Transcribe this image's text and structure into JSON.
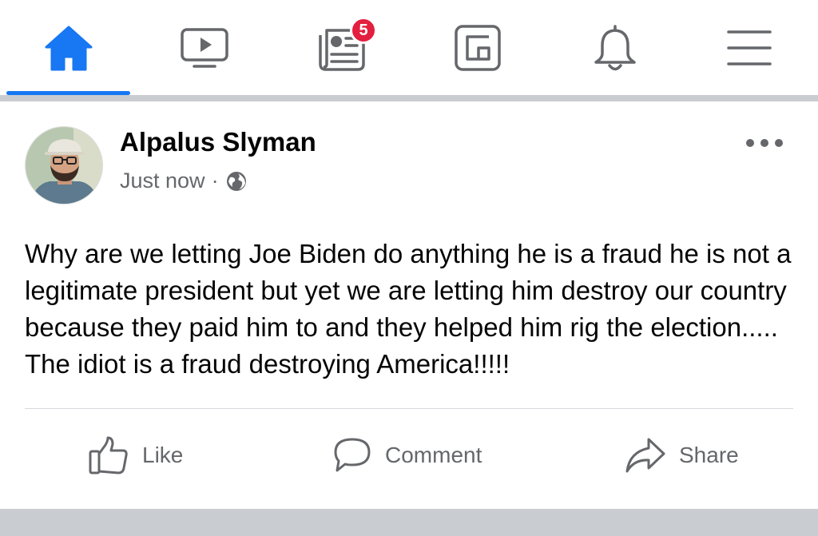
{
  "nav": {
    "tabs": [
      {
        "name": "home",
        "icon": "home-icon",
        "active": true
      },
      {
        "name": "watch",
        "icon": "video-icon"
      },
      {
        "name": "news",
        "icon": "newspaper-icon",
        "badge": "5"
      },
      {
        "name": "gaming",
        "icon": "gaming-icon"
      },
      {
        "name": "notifications",
        "icon": "bell-icon"
      },
      {
        "name": "menu",
        "icon": "hamburger-menu-icon"
      }
    ],
    "accent_color": "#1877f2",
    "badge_color": "#e41e3f"
  },
  "post": {
    "author": "Alpalus Slyman",
    "timestamp": "Just now",
    "separator": "·",
    "audience_icon": "globe-icon",
    "text": "Why are we letting Joe Biden do anything he is a fraud he is not a legitimate president but yet we are letting him destroy our country because they paid him to and they helped him rig the election..... The idiot is a fraud destroying America!!!!!",
    "actions": {
      "like": "Like",
      "comment": "Comment",
      "share": "Share"
    }
  }
}
